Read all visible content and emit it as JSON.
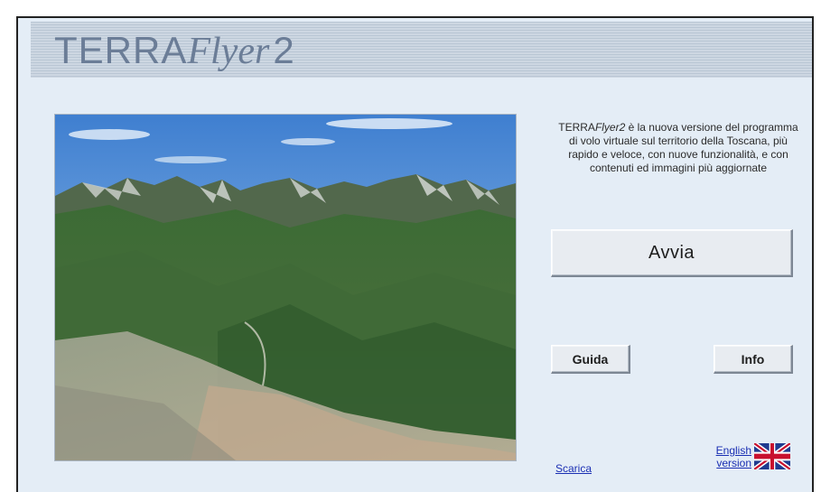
{
  "header": {
    "logo_terra": "TERRA",
    "logo_flyer": "Flyer",
    "logo_version": "2",
    "logo_color": "#6b7d97"
  },
  "main": {
    "description_brand_plain": "TERRA",
    "description_brand_italic": "Flyer2",
    "description_text": " è la nuova versione del programma di volo virtuale sul territorio della Toscana, più rapido e veloce, con nuove funzionalità, e con contenuti ed immagini più aggiornate",
    "buttons": {
      "start": "Avvia",
      "guide": "Guida",
      "info": "Info"
    },
    "links": {
      "download": "Scarica",
      "english_line1": "English",
      "english_line2": "version"
    },
    "icons": {
      "flag": "uk-flag-icon"
    }
  },
  "colors": {
    "background": "#e4edf6",
    "link": "#1a2fb3"
  }
}
